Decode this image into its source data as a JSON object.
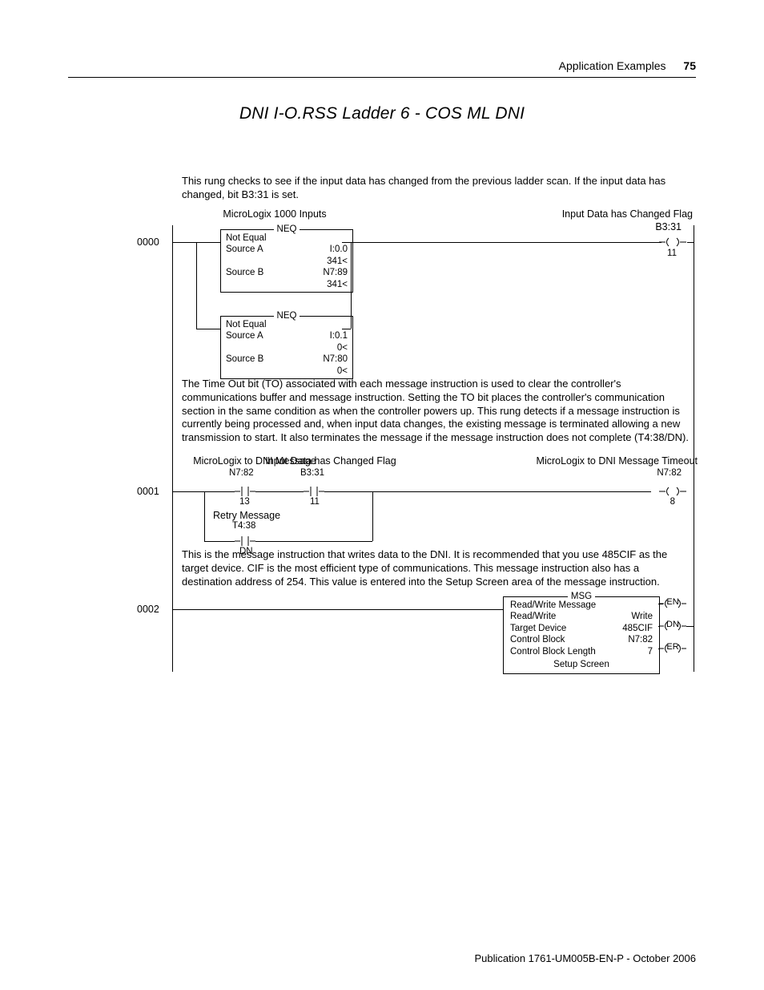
{
  "header": {
    "section": "Application Examples",
    "page": "75"
  },
  "title": "DNI I-O.RSS Ladder 6 - COS ML DNI",
  "footer": "Publication 1761-UM005B-EN-P - October 2006",
  "notes": {
    "n0": "This rung checks to see if the input data has changed from the previous ladder scan. If the input data has changed, bit B3:31 is set.",
    "n1": "The Time Out bit (TO) associated with each message instruction is used to clear the controller's communications buffer and message instruction. Setting the TO bit places the controller's communication section in the same condition as when the controller powers up. This rung detects if a message instruction is currently being processed and, when input data changes, the existing message is terminated allowing a new transmission to start. It also terminates the message if the message instruction does not complete (T4:38/DN).",
    "n2": "This is the message instruction that writes data to the DNI. It is recommended that you use 485CIF as the target device. CIF is the most efficient type of communications. This message instruction also has a destination address of 254. This value is entered into the Setup Screen area of the message instruction."
  },
  "rungs": {
    "r0": "0000",
    "r1": "0001",
    "r2": "0002"
  },
  "labels": {
    "mlx_inputs": "MicroLogix 1000 Inputs",
    "in_changed_flag": "Input Data has Changed Flag",
    "b331": "B3:31",
    "eleven": "11",
    "mlx_dni_msg": "MicroLogix to DNI Message",
    "n782": "N7:82",
    "thirteen": "13",
    "retry": "Retry Message",
    "t438": "T4:38",
    "dn": "DN",
    "mlx_dni_to": "MicroLogix to DNI Message Timeout",
    "eight": "8"
  },
  "neq": {
    "tag": "NEQ",
    "noteq": "Not Equal",
    "srcA": "Source A",
    "srcB": "Source B",
    "b1": {
      "a": "I:0.0",
      "av": "341<",
      "b": "N7:89",
      "bv": "341<"
    },
    "b2": {
      "a": "I:0.1",
      "av": "0<",
      "b": "N7:80",
      "bv": "0<"
    }
  },
  "msg": {
    "tag": "MSG",
    "title": "Read/Write Message",
    "rows": {
      "rw_l": "Read/Write",
      "rw_r": "Write",
      "td_l": "Target Device",
      "td_r": "485CIF",
      "cb_l": "Control Block",
      "cb_r": "N7:82",
      "cbl_l": "Control Block Length",
      "cbl_r": "7"
    },
    "setup": "Setup Screen",
    "en": "EN",
    "dn": "DN",
    "er": "ER"
  }
}
